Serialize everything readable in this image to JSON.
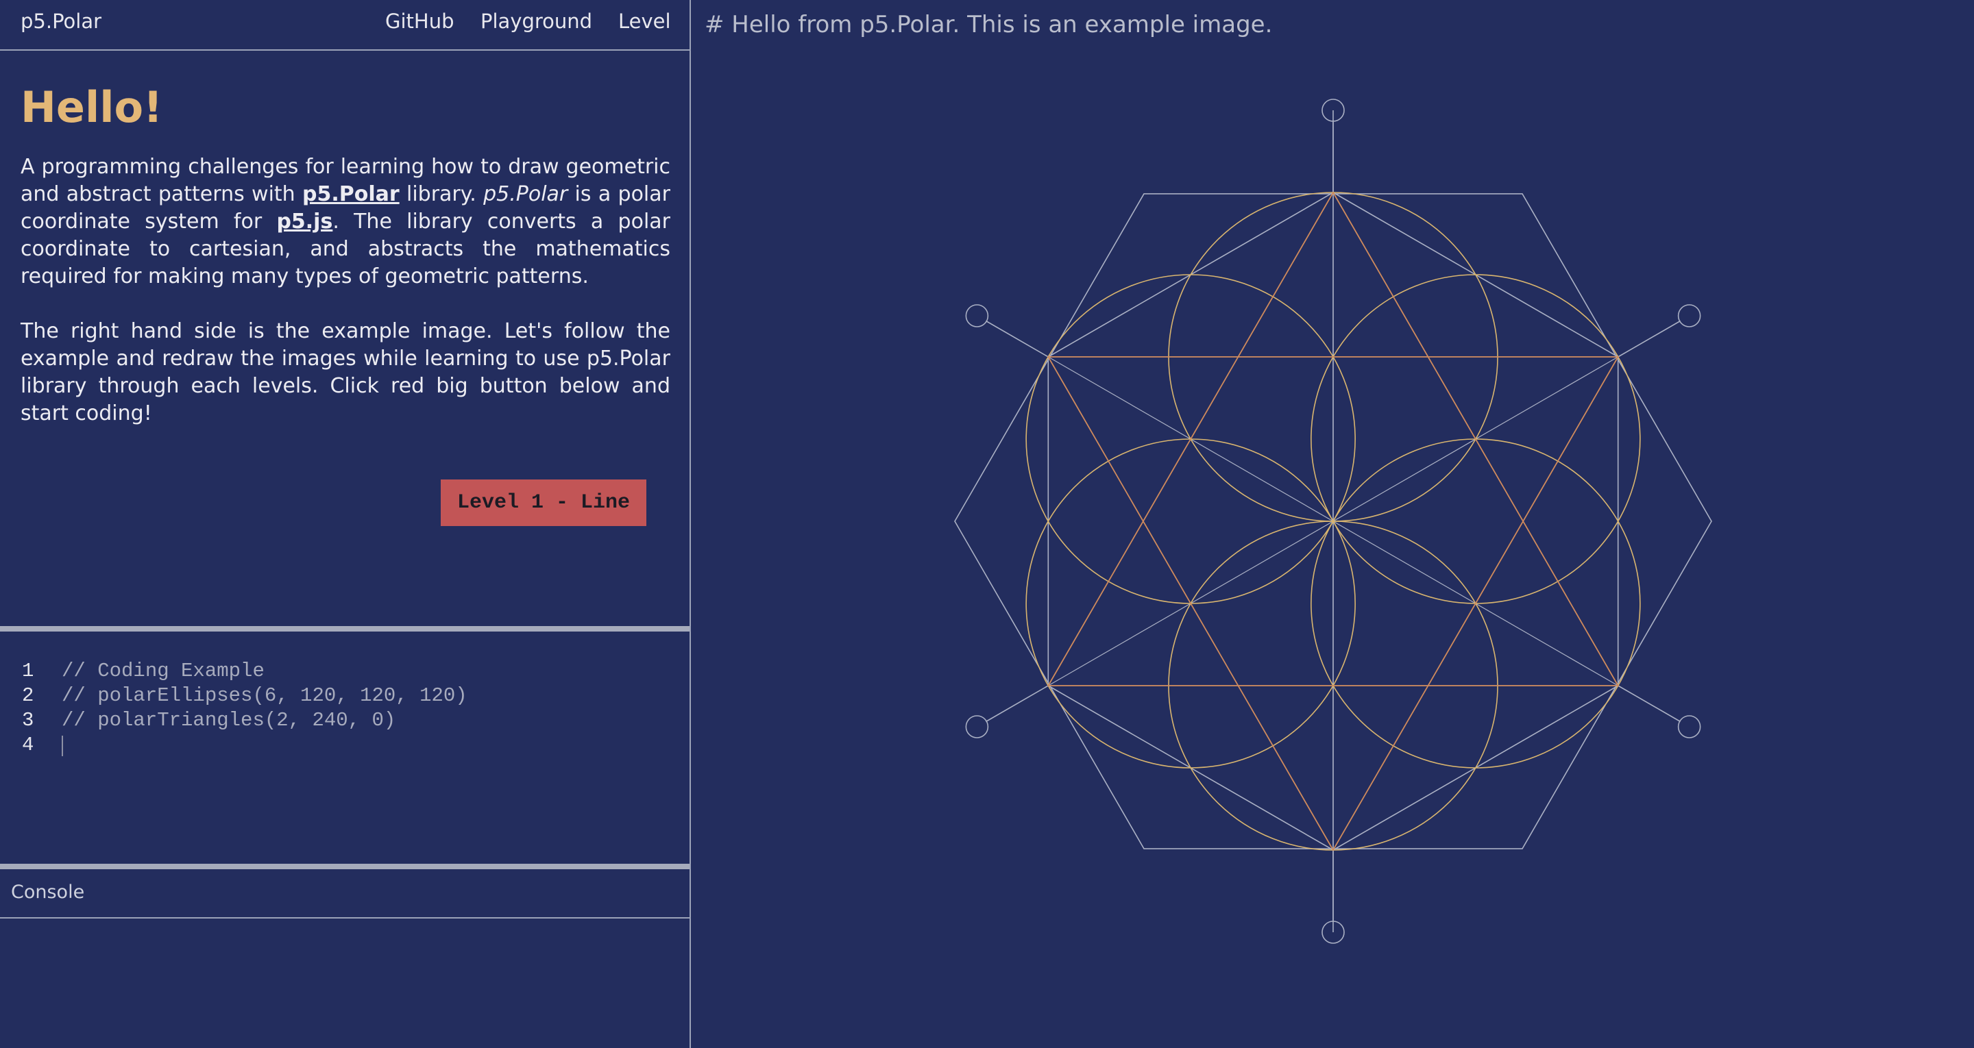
{
  "navbar": {
    "brand": "p5.Polar",
    "links": [
      "GitHub",
      "Playground",
      "Level"
    ]
  },
  "intro": {
    "heading": "Hello!",
    "para1_part1": "A programming challenges for learning how to draw geometric and abstract patterns with ",
    "para1_link1": "p5.Polar",
    "para1_part2": " library. ",
    "para1_italic": "p5.Polar",
    "para1_part3": " is a polar coordinate system for ",
    "para1_link2": "p5.js",
    "para1_part4": ". The library converts a polar coordinate to cartesian, and abstracts the mathematics required for making many types of geometric patterns.",
    "para2": "The right hand side is the example image. Let's follow the example and redraw the images while learning to use p5.Polar library through each levels. Click red big button below and start coding!"
  },
  "level_button": "Level 1 - Line",
  "editor": {
    "lines": [
      {
        "num": "1",
        "code": "// Coding Example"
      },
      {
        "num": "2",
        "code": "// polarEllipses(6, 120, 120, 120)"
      },
      {
        "num": "3",
        "code": "// polarTriangles(2, 240, 0)"
      },
      {
        "num": "4",
        "code": ""
      }
    ]
  },
  "console": {
    "label": "Console"
  },
  "canvas": {
    "heading": "# Hello from p5.Polar. This is an example image.",
    "colors": {
      "background": "#232d5e",
      "gold": "#d9b56f",
      "orange": "#cf8a5c",
      "grey": "#aab0c4"
    }
  }
}
